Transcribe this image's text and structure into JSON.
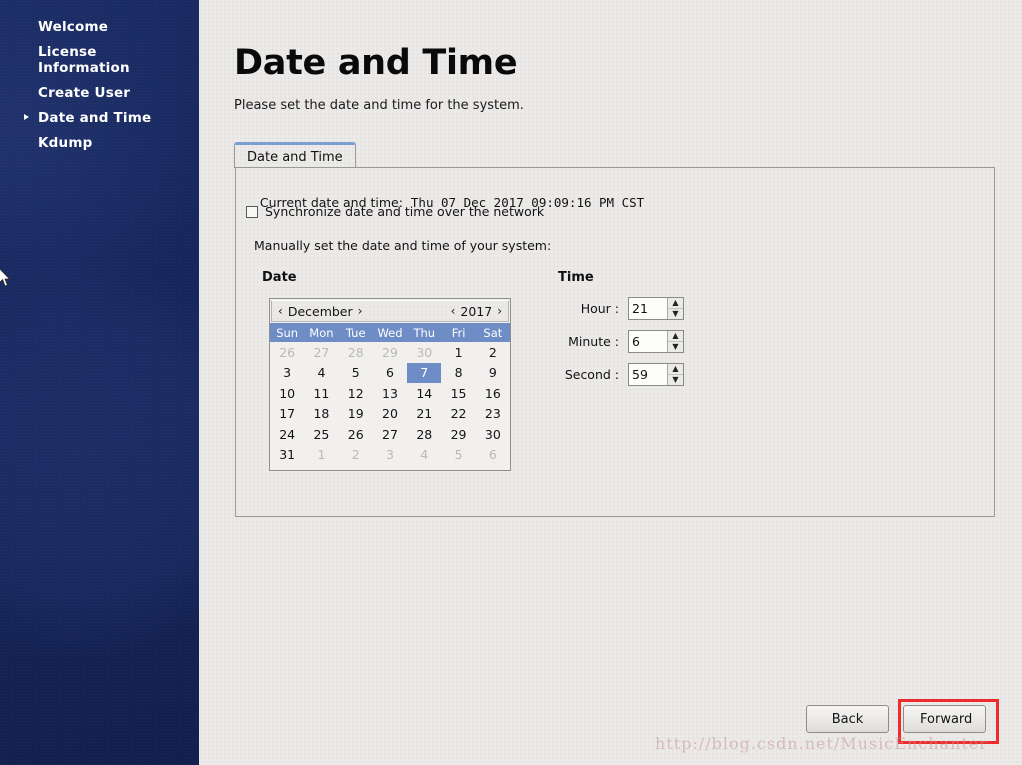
{
  "sidebar": {
    "items": [
      {
        "label": "Welcome",
        "active": false
      },
      {
        "label": "License\nInformation",
        "active": false
      },
      {
        "label": "Create User",
        "active": false
      },
      {
        "label": "Date and Time",
        "active": true
      },
      {
        "label": "Kdump",
        "active": false
      }
    ]
  },
  "page": {
    "title": "Date and Time",
    "subtitle": "Please set the date and time for the system."
  },
  "tabs": [
    {
      "label": "Date and Time",
      "selected": true
    }
  ],
  "panel": {
    "current_label": "Current date and time:",
    "current_value": "Thu 07 Dec 2017 09:09:16 PM CST",
    "sync_label": "Synchronize date and time over the network",
    "sync_checked": false,
    "manual_label": "Manually set the date and time of your system:",
    "date_heading": "Date",
    "time_heading": "Time"
  },
  "calendar": {
    "prev_month_icon": "‹",
    "next_month_icon": "›",
    "prev_year_icon": "‹",
    "next_year_icon": "›",
    "month": "December",
    "year": "2017",
    "weekdays": [
      "Sun",
      "Mon",
      "Tue",
      "Wed",
      "Thu",
      "Fri",
      "Sat"
    ],
    "selected_day": 7,
    "weeks": [
      [
        {
          "d": "26",
          "other": true
        },
        {
          "d": "27",
          "other": true
        },
        {
          "d": "28",
          "other": true
        },
        {
          "d": "29",
          "other": true
        },
        {
          "d": "30",
          "other": true
        },
        {
          "d": "1",
          "other": false
        },
        {
          "d": "2",
          "other": false
        }
      ],
      [
        {
          "d": "3",
          "other": false
        },
        {
          "d": "4",
          "other": false
        },
        {
          "d": "5",
          "other": false
        },
        {
          "d": "6",
          "other": false
        },
        {
          "d": "7",
          "other": false,
          "selected": true
        },
        {
          "d": "8",
          "other": false
        },
        {
          "d": "9",
          "other": false
        }
      ],
      [
        {
          "d": "10",
          "other": false
        },
        {
          "d": "11",
          "other": false
        },
        {
          "d": "12",
          "other": false
        },
        {
          "d": "13",
          "other": false
        },
        {
          "d": "14",
          "other": false
        },
        {
          "d": "15",
          "other": false
        },
        {
          "d": "16",
          "other": false
        }
      ],
      [
        {
          "d": "17",
          "other": false
        },
        {
          "d": "18",
          "other": false
        },
        {
          "d": "19",
          "other": false
        },
        {
          "d": "20",
          "other": false
        },
        {
          "d": "21",
          "other": false
        },
        {
          "d": "22",
          "other": false
        },
        {
          "d": "23",
          "other": false
        }
      ],
      [
        {
          "d": "24",
          "other": false
        },
        {
          "d": "25",
          "other": false
        },
        {
          "d": "26",
          "other": false
        },
        {
          "d": "27",
          "other": false
        },
        {
          "d": "28",
          "other": false
        },
        {
          "d": "29",
          "other": false
        },
        {
          "d": "30",
          "other": false
        }
      ],
      [
        {
          "d": "31",
          "other": false
        },
        {
          "d": "1",
          "other": true
        },
        {
          "d": "2",
          "other": true
        },
        {
          "d": "3",
          "other": true
        },
        {
          "d": "4",
          "other": true
        },
        {
          "d": "5",
          "other": true
        },
        {
          "d": "6",
          "other": true
        }
      ]
    ]
  },
  "time": {
    "fields": [
      {
        "label": "Hour :",
        "value": "21",
        "name": "hour"
      },
      {
        "label": "Minute :",
        "value": "6",
        "name": "minute"
      },
      {
        "label": "Second :",
        "value": "59",
        "name": "second"
      }
    ],
    "spin_up_icon": "▲",
    "spin_down_icon": "▼"
  },
  "footer": {
    "back_label": "Back",
    "forward_label": "Forward",
    "highlight_color": "#ef2b2b"
  },
  "watermark": "http://blog.csdn.net/MusicEnchanter",
  "colors": {
    "sidebar_bg": "#16265c",
    "content_bg": "#eceae8",
    "calendar_accent": "#6e8dc6",
    "tab_accent": "#7aa0d2"
  }
}
